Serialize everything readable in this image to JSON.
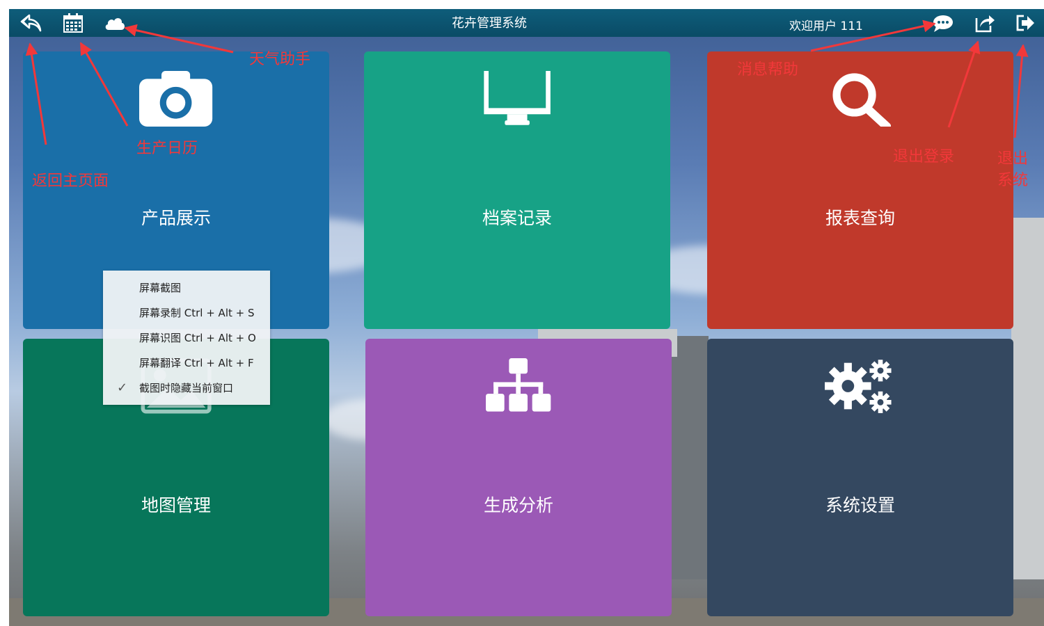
{
  "topbar": {
    "title": "花卉管理系统",
    "welcome": "欢迎用户 111",
    "icons": [
      "back-icon",
      "calendar-icon",
      "cloud-icon",
      "chat-icon",
      "share-icon",
      "exit-icon"
    ]
  },
  "tiles": [
    {
      "label": "产品展示",
      "icon": "camera-icon",
      "color": "#1a6fa8"
    },
    {
      "label": "档案记录",
      "icon": "monitor-icon",
      "color": "#17a286"
    },
    {
      "label": "报表查询",
      "icon": "search-icon",
      "color": "#c0392b"
    },
    {
      "label": "地图管理",
      "icon": "image-icon",
      "color": "#07765a"
    },
    {
      "label": "生成分析",
      "icon": "sitemap-icon",
      "color": "#9b59b6"
    },
    {
      "label": "系统设置",
      "icon": "gears-icon",
      "color": "#344860"
    }
  ],
  "context_menu": {
    "items": [
      {
        "label": "屏幕截图",
        "checked": false
      },
      {
        "label": "屏幕录制 Ctrl + Alt + S",
        "checked": false
      },
      {
        "label": "屏幕识图 Ctrl + Alt + O",
        "checked": false
      },
      {
        "label": "屏幕翻译 Ctrl + Alt + F",
        "checked": false
      },
      {
        "label": "截图时隐藏当前窗口",
        "checked": true
      }
    ],
    "check_glyph": "✓"
  },
  "annotations": {
    "weather": "天气助手",
    "calendar": "生产日历",
    "home": "返回主页面",
    "message": "消息帮助",
    "logout": "退出登录",
    "exit_line1": "退出",
    "exit_line2": "系统",
    "color": "#f2383a"
  }
}
